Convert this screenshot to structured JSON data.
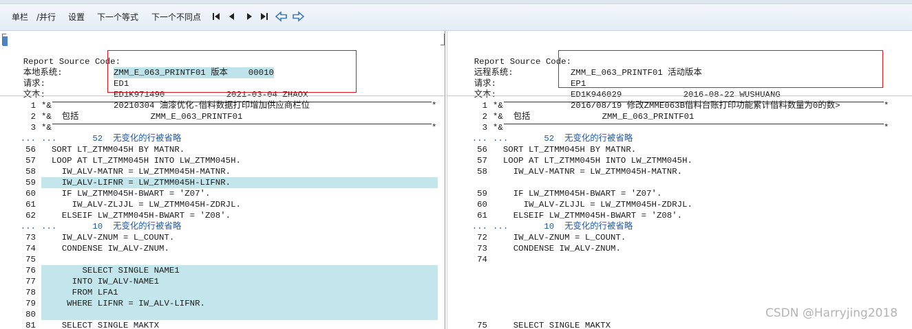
{
  "toolbar": {
    "items": [
      "单栏",
      "/并行",
      "设置",
      "下一个等式",
      "下一个不同点"
    ],
    "nav_icons": [
      "first-page-icon",
      "previous-page-icon",
      "next-page-icon",
      "last-page-icon",
      "arrow-left-icon",
      "arrow-right-icon"
    ]
  },
  "left": {
    "header": {
      "report_label": "Report Source Code:",
      "report_value": "ZMM_E_063_PRINTF01 版本    00010",
      "system_label": "本地系统:",
      "system_value": "ED1",
      "request_label": "请求:",
      "request_value": "ED1K971490            2021-03-04 ZHAOX",
      "text_label": "文本:",
      "text_value": "20210304 油漆优化-借料数据打印增加供应商栏位"
    },
    "rows": [
      {
        "ln": "1",
        "code": "*&",
        "type": "rule-top"
      },
      {
        "ln": "2",
        "code": "*&  包括              ZMM_E_063_PRINTF01",
        "type": "code"
      },
      {
        "ln": "3",
        "code": "*&",
        "type": "rule-bottom"
      },
      {
        "ln": "...",
        "code": "...       52  无变化的行被省略",
        "type": "omit"
      },
      {
        "ln": "56",
        "code": "  SORT LT_ZTMM045H BY MATNR.",
        "type": "code"
      },
      {
        "ln": "57",
        "code": "  LOOP AT LT_ZTMM045H INTO LW_ZTMM045H.",
        "type": "code"
      },
      {
        "ln": "58",
        "code": "    IW_ALV-MATNR = LW_ZTMM045H-MATNR.",
        "type": "code"
      },
      {
        "ln": "59",
        "code": "    IW_ALV-LIFNR = LW_ZTMM045H-LIFNR.",
        "type": "hl"
      },
      {
        "ln": "60",
        "code": "    IF LW_ZTMM045H-BWART = 'Z07'.",
        "type": "code"
      },
      {
        "ln": "61",
        "code": "      IW_ALV-ZLJJL = LW_ZTMM045H-ZDRJL.",
        "type": "code"
      },
      {
        "ln": "62",
        "code": "    ELSEIF LW_ZTMM045H-BWART = 'Z08'.",
        "type": "code"
      },
      {
        "ln": "...",
        "code": "...       10  无变化的行被省略",
        "type": "omit"
      },
      {
        "ln": "73",
        "code": "    IW_ALV-ZNUM = L_COUNT.",
        "type": "code"
      },
      {
        "ln": "74",
        "code": "    CONDENSE IW_ALV-ZNUM.",
        "type": "code"
      },
      {
        "ln": "75",
        "code": "",
        "type": "code"
      },
      {
        "ln": "76",
        "code": "        SELECT SINGLE NAME1",
        "type": "hl"
      },
      {
        "ln": "77",
        "code": "      INTO IW_ALV-NAME1",
        "type": "hl"
      },
      {
        "ln": "78",
        "code": "      FROM LFA1",
        "type": "hl"
      },
      {
        "ln": "79",
        "code": "     WHERE LIFNR = IW_ALV-LIFNR.",
        "type": "hl"
      },
      {
        "ln": "80",
        "code": "",
        "type": "hl"
      },
      {
        "ln": "81",
        "code": "    SELECT SINGLE MAKTX",
        "type": "code"
      }
    ]
  },
  "right": {
    "header": {
      "report_label": "Report Source Code:",
      "report_value": "ZMM_E_063_PRINTF01 活动版本",
      "system_label": "远程系统:",
      "system_value": "EP1",
      "request_label": "请求:",
      "request_value": "ED1K946029            2016-08-22 WUSHUANG",
      "text_label": "文本:",
      "text_value": "2016/08/19 修改ZMME063B借料台账打印功能累计借料数量为0的数>"
    },
    "rows": [
      {
        "ln": "1",
        "code": "*&",
        "type": "rule-top"
      },
      {
        "ln": "2",
        "code": "*&  包括              ZMM_E_063_PRINTF01",
        "type": "code"
      },
      {
        "ln": "3",
        "code": "*&",
        "type": "rule-bottom"
      },
      {
        "ln": "...",
        "code": "...       52  无变化的行被省略",
        "type": "omit"
      },
      {
        "ln": "56",
        "code": "  SORT LT_ZTMM045H BY MATNR.",
        "type": "code"
      },
      {
        "ln": "57",
        "code": "  LOOP AT LT_ZTMM045H INTO LW_ZTMM045H.",
        "type": "code"
      },
      {
        "ln": "58",
        "code": "    IW_ALV-MATNR = LW_ZTMM045H-MATNR.",
        "type": "code"
      },
      {
        "ln": "",
        "code": "",
        "type": "code"
      },
      {
        "ln": "59",
        "code": "    IF LW_ZTMM045H-BWART = 'Z07'.",
        "type": "code"
      },
      {
        "ln": "60",
        "code": "      IW_ALV-ZLJJL = LW_ZTMM045H-ZDRJL.",
        "type": "code"
      },
      {
        "ln": "61",
        "code": "    ELSEIF LW_ZTMM045H-BWART = 'Z08'.",
        "type": "code"
      },
      {
        "ln": "...",
        "code": "...       10  无变化的行被省略",
        "type": "omit"
      },
      {
        "ln": "72",
        "code": "    IW_ALV-ZNUM = L_COUNT.",
        "type": "code"
      },
      {
        "ln": "73",
        "code": "    CONDENSE IW_ALV-ZNUM.",
        "type": "code"
      },
      {
        "ln": "74",
        "code": "",
        "type": "code"
      },
      {
        "ln": "",
        "code": "",
        "type": "code"
      },
      {
        "ln": "",
        "code": "",
        "type": "code"
      },
      {
        "ln": "",
        "code": "",
        "type": "code"
      },
      {
        "ln": "",
        "code": "",
        "type": "code"
      },
      {
        "ln": "",
        "code": "",
        "type": "code"
      },
      {
        "ln": "75",
        "code": "    SELECT SINGLE MAKTX",
        "type": "code"
      }
    ]
  },
  "colors": {
    "highlight": "#c3e6ec",
    "omit_text": "#1f5aa8",
    "redbox": "#e0141e",
    "toolbar_arrows": "#3a78c4"
  },
  "watermark": "CSDN @Harryjing2018"
}
